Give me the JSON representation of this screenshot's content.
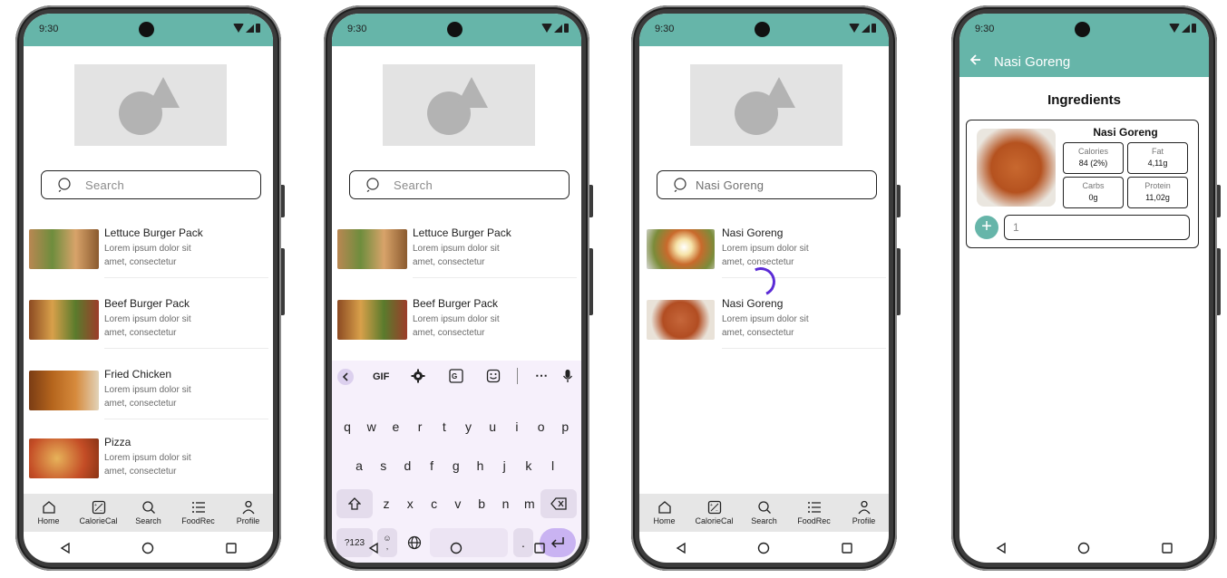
{
  "status": {
    "time": "9:30"
  },
  "search": {
    "placeholder": "Search",
    "query": "Nasi Goreng"
  },
  "food_list": [
    {
      "title": "Lettuce Burger Pack",
      "line1": "Lorem ipsum dolor sit",
      "line2": "amet, consectetur"
    },
    {
      "title": "Beef Burger Pack",
      "line1": "Lorem ipsum dolor sit",
      "line2": "amet, consectetur"
    },
    {
      "title": "Fried Chicken",
      "line1": "Lorem ipsum dolor sit",
      "line2": "amet, consectetur"
    },
    {
      "title": "Pizza",
      "line1": "Lorem ipsum dolor sit",
      "line2": "amet, consectetur"
    }
  ],
  "results": [
    {
      "title": "Nasi Goreng",
      "line1": "Lorem ipsum dolor sit",
      "line2": "amet, consectetur"
    },
    {
      "title": "Nasi Goreng",
      "line1": "Lorem ipsum dolor sit",
      "line2": "amet, consectetur"
    }
  ],
  "nav": {
    "home": "Home",
    "caloriecal": "CalorieCal",
    "search": "Search",
    "foodrec": "FoodRec",
    "profile": "Profile"
  },
  "keyboard": {
    "gif": "GIF",
    "row1": [
      "q",
      "w",
      "e",
      "r",
      "t",
      "y",
      "u",
      "i",
      "o",
      "p"
    ],
    "row2": [
      "a",
      "s",
      "d",
      "f",
      "g",
      "h",
      "j",
      "k",
      "l"
    ],
    "row3": [
      "z",
      "x",
      "c",
      "v",
      "b",
      "n",
      "m"
    ],
    "symbols": "?123",
    "period": ".",
    "comma": ","
  },
  "detail": {
    "title": "Nasi Goreng",
    "heading": "Ingredients",
    "card_title": "Nasi Goreng",
    "nutrients": [
      {
        "label": "Calories",
        "value": "84 (2%)"
      },
      {
        "label": "Fat",
        "value": "4,11g"
      },
      {
        "label": "Carbs",
        "value": "0g"
      },
      {
        "label": "Protein",
        "value": "11,02g"
      }
    ],
    "quantity": "1"
  },
  "colors": {
    "accent": "#66b5a9",
    "spinner": "#5b2bd6",
    "keyboard_bg": "#f6f0fb"
  }
}
